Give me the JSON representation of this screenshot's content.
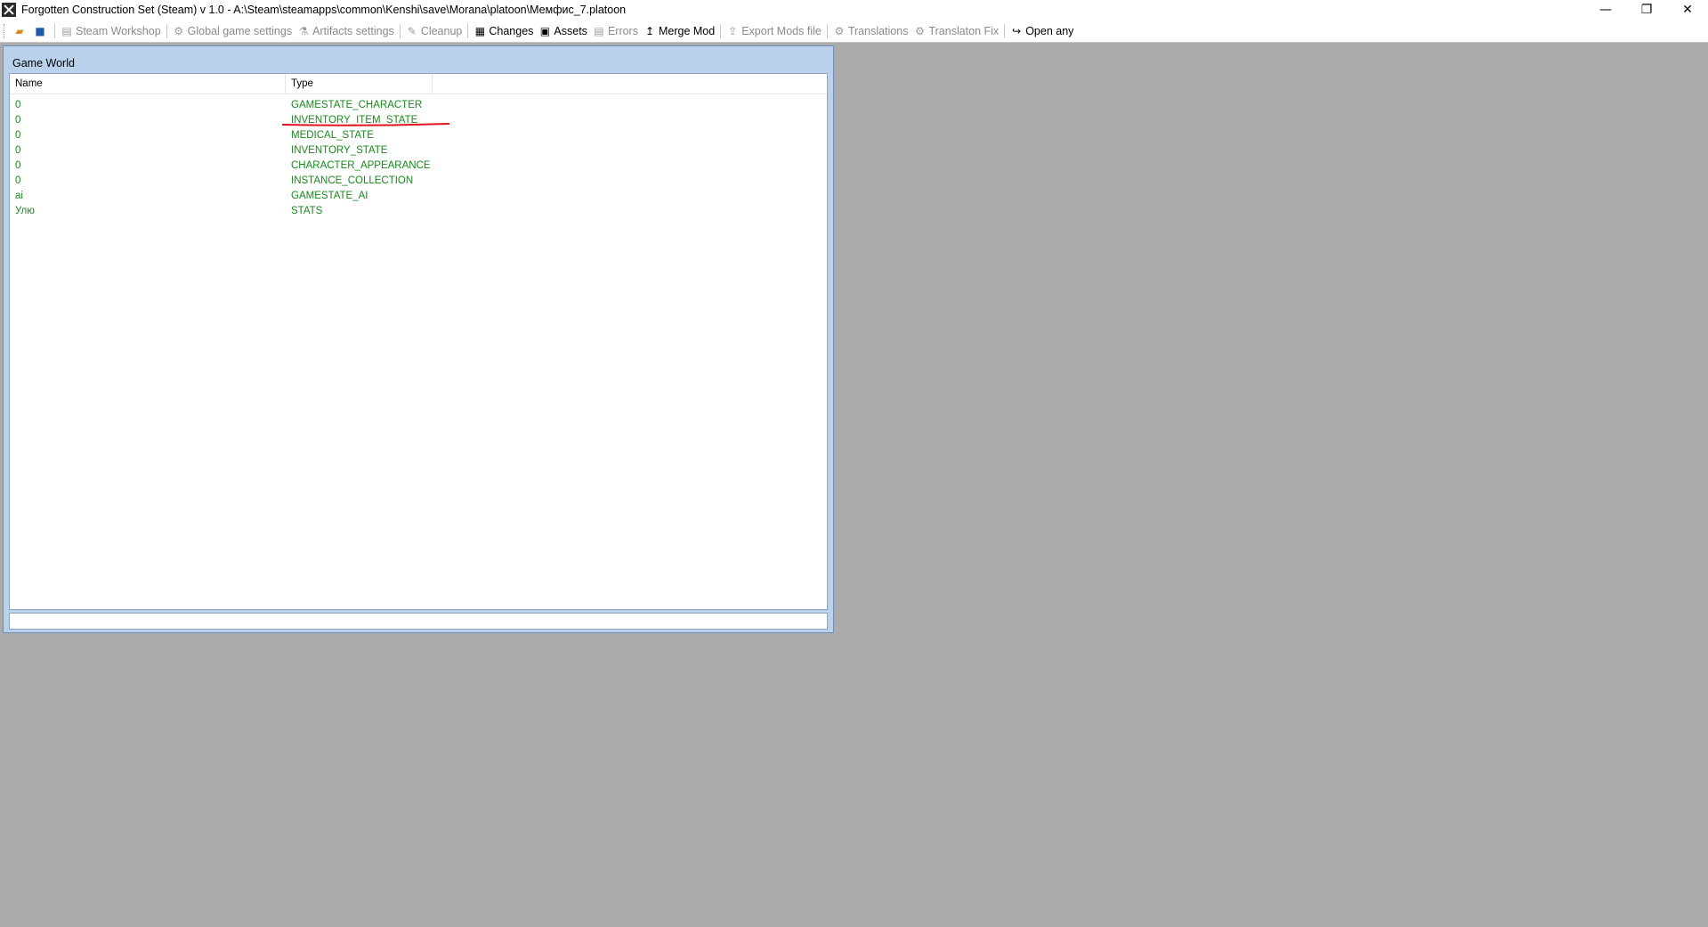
{
  "window": {
    "title": "Forgotten Construction Set (Steam) v 1.0 - A:\\Steam\\steamapps\\common\\Kenshi\\save\\Morana\\platoon\\Мемфис_7.platoon",
    "minimize": "—",
    "restore": "❐",
    "close": "✕"
  },
  "toolbar": {
    "items": [
      {
        "label": "Steam Workshop",
        "icon": "steam-icon",
        "glyph": "▤",
        "enabled": false
      },
      {
        "label": "Global game settings",
        "icon": "gear-icon",
        "glyph": "⚙",
        "enabled": false
      },
      {
        "label": "Artifacts settings",
        "icon": "artifact-icon",
        "glyph": "⚗",
        "enabled": false
      },
      {
        "label": "Cleanup",
        "icon": "broom-icon",
        "glyph": "✎",
        "enabled": false
      },
      {
        "label": "Changes",
        "icon": "changes-icon",
        "glyph": "▦",
        "enabled": true
      },
      {
        "label": "Assets",
        "icon": "assets-icon",
        "glyph": "▣",
        "enabled": true
      },
      {
        "label": "Errors",
        "icon": "errors-icon",
        "glyph": "▤",
        "enabled": false
      },
      {
        "label": "Merge Mod",
        "icon": "merge-icon",
        "glyph": "↥",
        "enabled": true
      },
      {
        "label": "Export Mods file",
        "icon": "export-icon",
        "glyph": "⇪",
        "enabled": false
      },
      {
        "label": "Translations",
        "icon": "translations-icon",
        "glyph": "⚙",
        "enabled": false
      },
      {
        "label": "Translaton Fix",
        "icon": "translation-fix-icon",
        "glyph": "⚙",
        "enabled": false
      },
      {
        "label": "Open any",
        "icon": "open-any-icon",
        "glyph": "↪",
        "enabled": true
      }
    ]
  },
  "game_world": {
    "title": "Game World",
    "columns": {
      "name": "Name",
      "type": "Type"
    },
    "rows": [
      {
        "name": "0",
        "type": "GAMESTATE_CHARACTER"
      },
      {
        "name": "0",
        "type": "INVENTORY_ITEM_STATE"
      },
      {
        "name": "0",
        "type": "MEDICAL_STATE"
      },
      {
        "name": "0",
        "type": "INVENTORY_STATE"
      },
      {
        "name": "0",
        "type": "CHARACTER_APPEARANCE"
      },
      {
        "name": "0",
        "type": "INSTANCE_COLLECTION"
      },
      {
        "name": "ai",
        "type": "GAMESTATE_AI"
      },
      {
        "name": "Улю",
        "type": "STATS"
      }
    ],
    "status_text": ""
  },
  "colors": {
    "row_text": "#18891b",
    "annotation": "#e0141e",
    "workspace": "#ababab"
  }
}
